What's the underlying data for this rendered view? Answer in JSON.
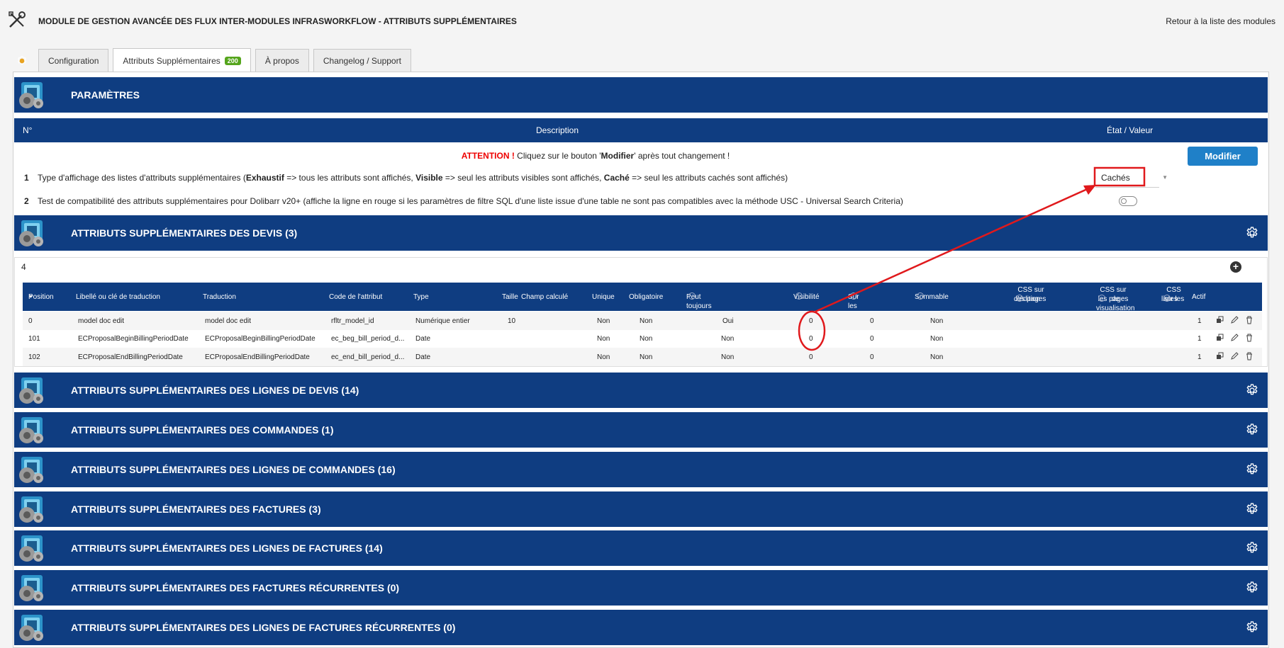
{
  "header": {
    "title": "MODULE DE GESTION AVANCÉE DES FLUX INTER-MODULES INFRASWORKFLOW - ATTRIBUTS SUPPLÉMENTAIRES",
    "back_link": "Retour à la liste des modules"
  },
  "tabs": [
    {
      "label": "Configuration"
    },
    {
      "label": "Attributs Supplémentaires",
      "badge": "200"
    },
    {
      "label": "À propos"
    },
    {
      "label": "Changelog / Support"
    }
  ],
  "params": {
    "title": "PARAMÈTRES",
    "col_num": "N°",
    "col_desc": "Description",
    "col_state": "État / Valeur",
    "attention_word": "ATTENTION !",
    "attention_pre": " Cliquez sur le bouton '",
    "attention_button": "Modifier",
    "attention_post": "' après tout changement !",
    "modify_label": "Modifier",
    "row1_num": "1",
    "row1_a": "Type d'affichage des listes d'attributs supplémentaires (",
    "row1_b": "Exhaustif",
    "row1_c": " => tous les attributs sont affichés, ",
    "row1_d": "Visible",
    "row1_e": " => seul les attributs visibles sont affichés, ",
    "row1_f": "Caché",
    "row1_g": " => seul les attributs cachés sont affichés)",
    "row1_value": "Cachés",
    "row2_num": "2",
    "row2_desc": "Test de compatibilité des attributs supplémentaires pour Dolibarr v20+ (affiche la ligne en rouge si les paramètres de filtre SQL d'une liste issue d'une table ne sont pas compatibles avec la méthode USC - Universal Search Criteria)"
  },
  "devis": {
    "title": "ATTRIBUTS SUPPLÉMENTAIRES DES DEVIS (3)",
    "count": "4",
    "columns": {
      "position": "Position",
      "label": "Libellé ou clé de traduction",
      "translation": "Traduction",
      "code": "Code de l'attribut",
      "type": "Type",
      "size": "Taille",
      "computed": "Champ calculé",
      "unique": "Unique",
      "required": "Obligatoire",
      "always_editable": "Peut toujours être édité",
      "visibility": "Visibilité",
      "on_pdf": "Sur les PDF",
      "summable": "Sommable",
      "css_edit_1": "CSS sur les pages",
      "css_edit_2": "d'édition",
      "css_view_1": "CSS sur les pages",
      "css_view_2": "de visualisation",
      "css_list_1": "CSS sur les",
      "css_list_2": "listes",
      "active": "Actif"
    },
    "rows": [
      {
        "position": "0",
        "label": "model doc edit",
        "translation": "model doc edit",
        "code": "rfltr_model_id",
        "type": "Numérique entier",
        "size": "10",
        "unique": "Non",
        "required": "Non",
        "always_editable": "Oui",
        "visibility": "0",
        "on_pdf": "0",
        "summable": "Non",
        "active": "1"
      },
      {
        "position": "101",
        "label": "ECProposalBeginBillingPeriodDate",
        "translation": "ECProposalBeginBillingPeriodDate",
        "code": "ec_beg_bill_period_d...",
        "type": "Date",
        "size": "",
        "unique": "Non",
        "required": "Non",
        "always_editable": "Non",
        "visibility": "0",
        "on_pdf": "0",
        "summable": "Non",
        "active": "1"
      },
      {
        "position": "102",
        "label": "ECProposalEndBillingPeriodDate",
        "translation": "ECProposalEndBillingPeriodDate",
        "code": "ec_end_bill_period_d...",
        "type": "Date",
        "size": "",
        "unique": "Non",
        "required": "Non",
        "always_editable": "Non",
        "visibility": "0",
        "on_pdf": "0",
        "summable": "Non",
        "active": "1"
      }
    ]
  },
  "sections": [
    {
      "title": "ATTRIBUTS SUPPLÉMENTAIRES DES LIGNES DE DEVIS (14)"
    },
    {
      "title": "ATTRIBUTS SUPPLÉMENTAIRES DES COMMANDES (1)"
    },
    {
      "title": "ATTRIBUTS SUPPLÉMENTAIRES DES LIGNES DE COMMANDES (16)"
    },
    {
      "title": "ATTRIBUTS SUPPLÉMENTAIRES DES FACTURES (3)"
    },
    {
      "title": "ATTRIBUTS SUPPLÉMENTAIRES DES LIGNES DE FACTURES (14)"
    },
    {
      "title": "ATTRIBUTS SUPPLÉMENTAIRES DES FACTURES RÉCURRENTES (0)"
    },
    {
      "title": "ATTRIBUTS SUPPLÉMENTAIRES DES LIGNES DE FACTURES RÉCURRENTES (0)"
    }
  ],
  "colors": {
    "section_bg": "#0f3d81",
    "button_bg": "#1f80c8",
    "badge_bg": "#55a51c",
    "annotation": "#e0191c"
  },
  "icons": [
    "tools-icon",
    "gear-icon",
    "module-logo-icon",
    "plus-icon",
    "copy-icon",
    "edit-icon",
    "trash-icon",
    "info-icon",
    "toggle-off-icon",
    "sort-down-icon"
  ]
}
